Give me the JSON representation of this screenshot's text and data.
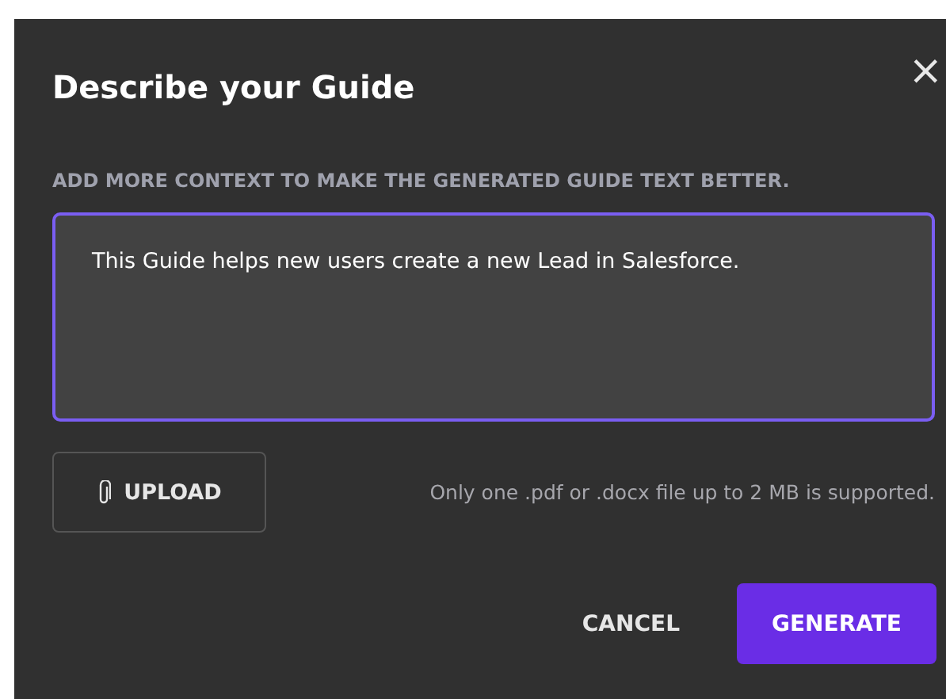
{
  "dialog": {
    "title": "Describe your Guide",
    "close": "×",
    "field_label": "ADD MORE CONTEXT TO MAKE THE GENERATED GUIDE TEXT BETTER.",
    "description": {
      "value": "This Guide helps new users create a new Lead in Salesforce."
    },
    "upload_button": "UPLOAD",
    "upload_hint": "Only one .pdf or .docx file up to 2 MB is supported.",
    "buttons": [
      {
        "kind": "text",
        "label": "CANCEL"
      },
      {
        "kind": "primary",
        "label": "GENERATE"
      }
    ]
  }
}
